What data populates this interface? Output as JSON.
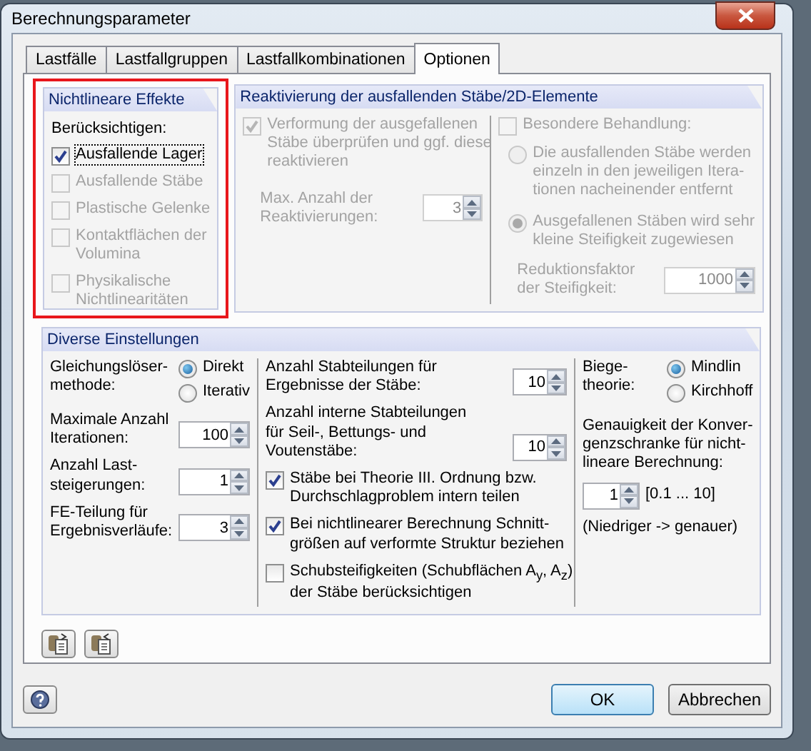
{
  "window": {
    "title": "Berechnungsparameter"
  },
  "tabs": [
    {
      "label": "Lastfälle",
      "selected": false
    },
    {
      "label": "Lastfallgruppen",
      "selected": false
    },
    {
      "label": "Lastfallkombinationen",
      "selected": false
    },
    {
      "label": "Optionen",
      "selected": true
    }
  ],
  "nonlinear": {
    "title": "Nichtlineare Effekte",
    "highlighted": true,
    "label": "Berücksichtigen:",
    "options": [
      {
        "label": "Ausfallende Lager",
        "checked": true,
        "disabled": false,
        "focused": true
      },
      {
        "label": "Ausfallende Stäbe",
        "checked": false,
        "disabled": true,
        "focused": false
      },
      {
        "label": "Plastische Gelenke",
        "checked": false,
        "disabled": true,
        "focused": false
      },
      {
        "label": "Kontaktflächen der\nVolumina",
        "checked": false,
        "disabled": true,
        "focused": false
      },
      {
        "label": "Physikalische\nNichtlinearitäten",
        "checked": false,
        "disabled": true,
        "focused": false
      }
    ]
  },
  "reactivation": {
    "title": "Reaktivierung der ausfallenden Stäbe/2D-Elemente",
    "deformation": {
      "label": "Verformung der ausgefallenen\nStäbe überprüfen und ggf. diese\nreaktivieren",
      "checked": true,
      "disabled": true
    },
    "max": {
      "label": "Max. Anzahl der\nReaktivierungen:",
      "value": "3",
      "disabled": true
    },
    "special": {
      "label": "Besondere Behandlung:",
      "checked": false,
      "disabled": true
    },
    "radios": [
      {
        "label": "Die ausfallenden Stäbe werden\neinzeln in den jeweiligen Itera-\ntionen nacheinender entfernt",
        "selected": false,
        "disabled": true
      },
      {
        "label": "Ausgefallenen Stäben wird sehr\nkleine Steifigkeit zugewiesen",
        "selected": true,
        "disabled": true
      }
    ],
    "factor": {
      "label": "Reduktionsfaktor\nder Steifigkeit:",
      "value": "1000",
      "disabled": true
    }
  },
  "misc": {
    "title": "Diverse Einstellungen",
    "solver": {
      "label": "Gleichungslöser-\nmethode:",
      "radios": [
        {
          "label": "Direkt",
          "selected": true
        },
        {
          "label": "Iterativ",
          "selected": false
        }
      ]
    },
    "spinners": [
      {
        "label": "Maximale Anzahl\nIterationen:",
        "value": "100"
      },
      {
        "label": "Anzahl Last-\nsteigerungen:",
        "value": "1"
      },
      {
        "label": "FE-Teilung für\nErgebnisverläufe:",
        "value": "3"
      }
    ],
    "divisions": [
      {
        "label": "Anzahl Stabteilungen für\nErgebnisse der Stäbe:",
        "value": "10"
      },
      {
        "label": "Anzahl interne Stabteilungen\nfür Seil-, Bettungs- und\nVoutenstäbe:",
        "value": "10"
      }
    ],
    "checks": [
      {
        "label": "Stäbe bei Theorie III. Ordnung bzw.\nDurchschlagproblem intern teilen",
        "checked": true
      },
      {
        "label": "Bei nichtlinearer Berechnung Schnitt-\ngrößen auf verformte Struktur beziehen",
        "checked": true
      },
      {
        "label": "Schubsteifigkeiten (Schubflächen A$_{y}$, A$_{z}$)\nder Stäbe berücksichtigen",
        "checked": false
      }
    ],
    "theory": {
      "label": "Biege-\ntheorie:",
      "radios": [
        {
          "label": "Mindlin",
          "selected": true
        },
        {
          "label": "Kirchhoff",
          "selected": false
        }
      ]
    },
    "accuracy": {
      "label": "Genauigkeit der Konver-\ngenzschranke für nicht-\nlineare Berechnung:",
      "value": "1",
      "range": "[0.1 ... 10]",
      "note": "(Niedriger -> genauer)"
    }
  },
  "buttons": [
    {
      "label": "OK",
      "kind": "default"
    },
    {
      "label": "Abbrechen",
      "kind": "normal"
    }
  ]
}
